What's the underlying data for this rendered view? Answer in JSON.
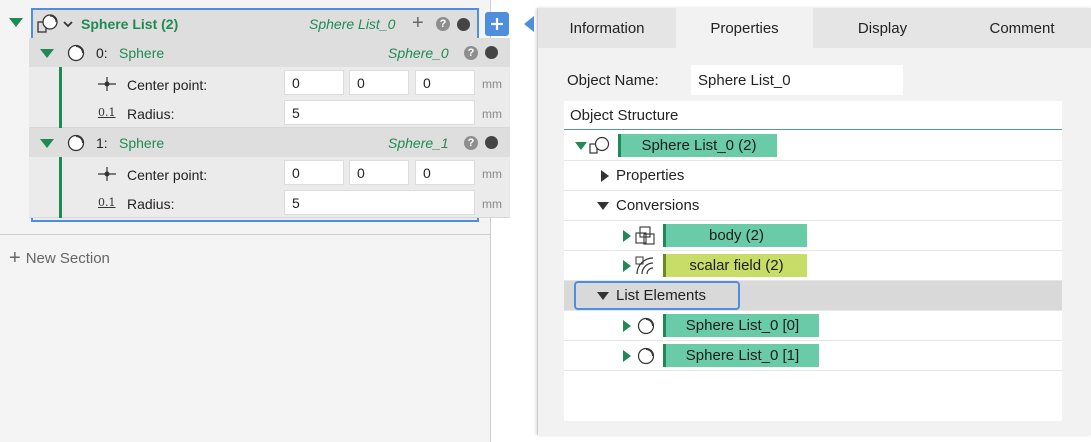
{
  "left": {
    "list_node": {
      "title": "Sphere List (2)",
      "object_name": "Sphere List_0",
      "add_icon": "plus-icon",
      "help_icon": "question-icon",
      "status_icon": "dot-icon",
      "items": [
        {
          "index": "0:",
          "type": "Sphere",
          "name": "Sphere_0",
          "center_label": "Center point:",
          "center": [
            "0",
            "0",
            "0"
          ],
          "center_unit": "mm",
          "radius_icon": "0.1",
          "radius_label": "Radius:",
          "radius": "5",
          "radius_unit": "mm"
        },
        {
          "index": "1:",
          "type": "Sphere",
          "name": "Sphere_1",
          "center_label": "Center point:",
          "center": [
            "0",
            "0",
            "0"
          ],
          "center_unit": "mm",
          "radius_icon": "0.1",
          "radius_label": "Radius:",
          "radius": "5",
          "radius_unit": "mm"
        }
      ]
    },
    "new_section": "New Section",
    "add_node_icon": "plus-icon"
  },
  "right": {
    "tabs": [
      {
        "label": "Information",
        "active": false
      },
      {
        "label": "Properties",
        "active": true
      },
      {
        "label": "Display",
        "active": false
      },
      {
        "label": "Comment",
        "active": false
      }
    ],
    "object_name_label": "Object Name:",
    "object_name_value": "Sphere List_0",
    "structure_label": "Object Structure",
    "tree": {
      "root": "Sphere List_0 (2)",
      "properties": "Properties",
      "conversions": "Conversions",
      "body": "body (2)",
      "scalar_field": "scalar field (2)",
      "list_elements": "List Elements",
      "element0": "Sphere List_0 [0]",
      "element1": "Sphere List_0 [1]"
    }
  },
  "colors": {
    "accent_blue": "#4d8fdc",
    "node_green": "#1f8a54",
    "tag_teal": "#6acba9",
    "tag_lime": "#c8dc68"
  }
}
